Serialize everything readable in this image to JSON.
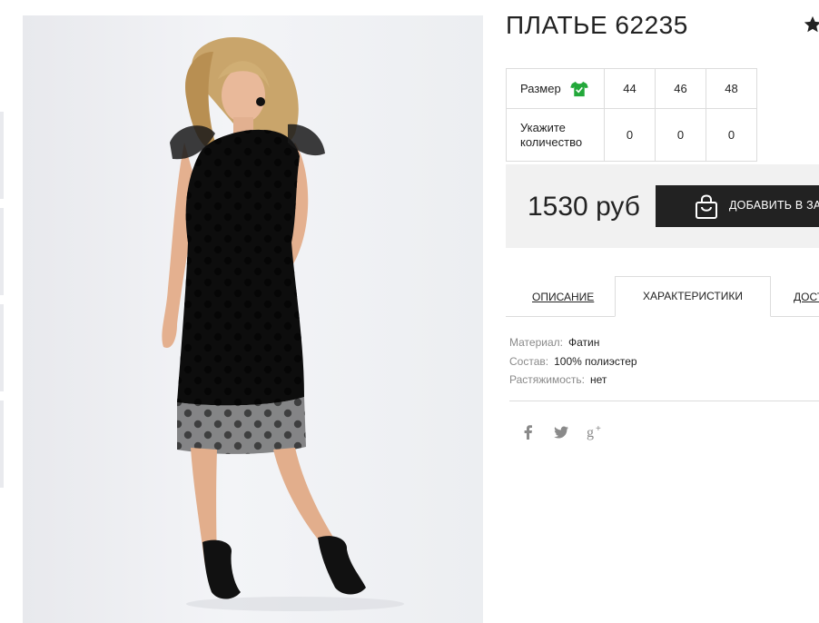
{
  "product": {
    "title": "ПЛАТЬЕ 62235",
    "favorite_icon": "star-icon",
    "image_alt": "dress-photo"
  },
  "sizes": {
    "size_label": "Размер",
    "size_icon": "tshirt-icon",
    "size_icon_color": "#23a83a",
    "quantity_label_line1": "Укажите",
    "quantity_label_line2": "количество",
    "items": [
      {
        "size": "44",
        "qty": "0"
      },
      {
        "size": "46",
        "qty": "0"
      },
      {
        "size": "48",
        "qty": "0"
      }
    ]
  },
  "buy": {
    "price": "1530 руб",
    "add_to_cart_label": "ДОБАВИТЬ В ЗА",
    "cart_icon": "shopping-bag-icon",
    "button_color": "#222222"
  },
  "tabs": [
    {
      "label": "ОПИСАНИЕ",
      "active": false
    },
    {
      "label": "ХАРАКТЕРИСТИКИ",
      "active": true
    },
    {
      "label": "ДОСТ",
      "active": false
    }
  ],
  "specs": [
    {
      "key": "Материал:",
      "value": "Фатин"
    },
    {
      "key": "Состав:",
      "value": "100% полиэстер"
    },
    {
      "key": "Растяжимость:",
      "value": "нет"
    }
  ],
  "social": [
    "facebook-icon",
    "twitter-icon",
    "google-plus-icon"
  ]
}
